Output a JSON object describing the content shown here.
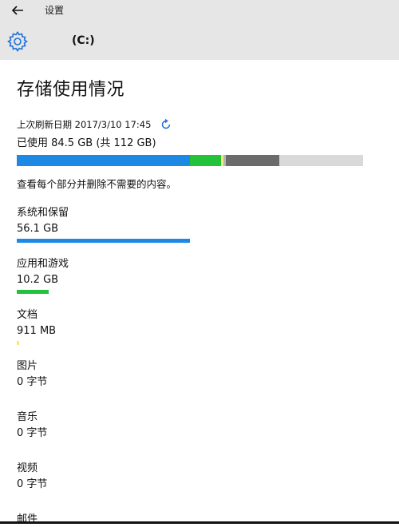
{
  "window": {
    "title": "设置",
    "back_icon": "back-arrow-icon"
  },
  "header": {
    "drive_label": "(C:)",
    "icon": "gear-icon"
  },
  "page": {
    "title": "存储使用情况",
    "refresh_text": "上次刷新日期 2017/3/10 17:45",
    "used_text": "已使用 84.5 GB (共 112 GB)",
    "hint_text": "查看每个部分并删除不需要的内容。"
  },
  "usage_bar": {
    "segments": [
      {
        "name": "系统和保留",
        "fraction": 0.5,
        "color": "#1e88e5"
      },
      {
        "name": "应用和游戏",
        "fraction": 0.09,
        "color": "#22c33a"
      },
      {
        "name": "文档",
        "fraction": 0.008,
        "color": "#f2ec7a"
      },
      {
        "name": "other-1",
        "fraction": 0.008,
        "color": "#b5b5b5"
      },
      {
        "name": "other-2",
        "fraction": 0.155,
        "color": "#6b6b6b"
      }
    ],
    "background": "#d9d9d9"
  },
  "categories": [
    {
      "name": "系统和保留",
      "size": "56.1 GB",
      "bar_fraction": 0.5,
      "color": "#1e88e5"
    },
    {
      "name": "应用和游戏",
      "size": "10.2 GB",
      "bar_fraction": 0.093,
      "color": "#22c33a"
    },
    {
      "name": "文档",
      "size": "911 MB",
      "bar_fraction": 0.008,
      "color": "#f2ec7a"
    },
    {
      "name": "图片",
      "size": "0 字节",
      "bar_fraction": 0,
      "color": "#cccccc"
    },
    {
      "name": "音乐",
      "size": "0 字节",
      "bar_fraction": 0,
      "color": "#cccccc"
    },
    {
      "name": "视频",
      "size": "0 字节",
      "bar_fraction": 0,
      "color": "#cccccc"
    },
    {
      "name": "邮件",
      "size": "",
      "bar_fraction": 0,
      "color": "#cccccc"
    }
  ]
}
